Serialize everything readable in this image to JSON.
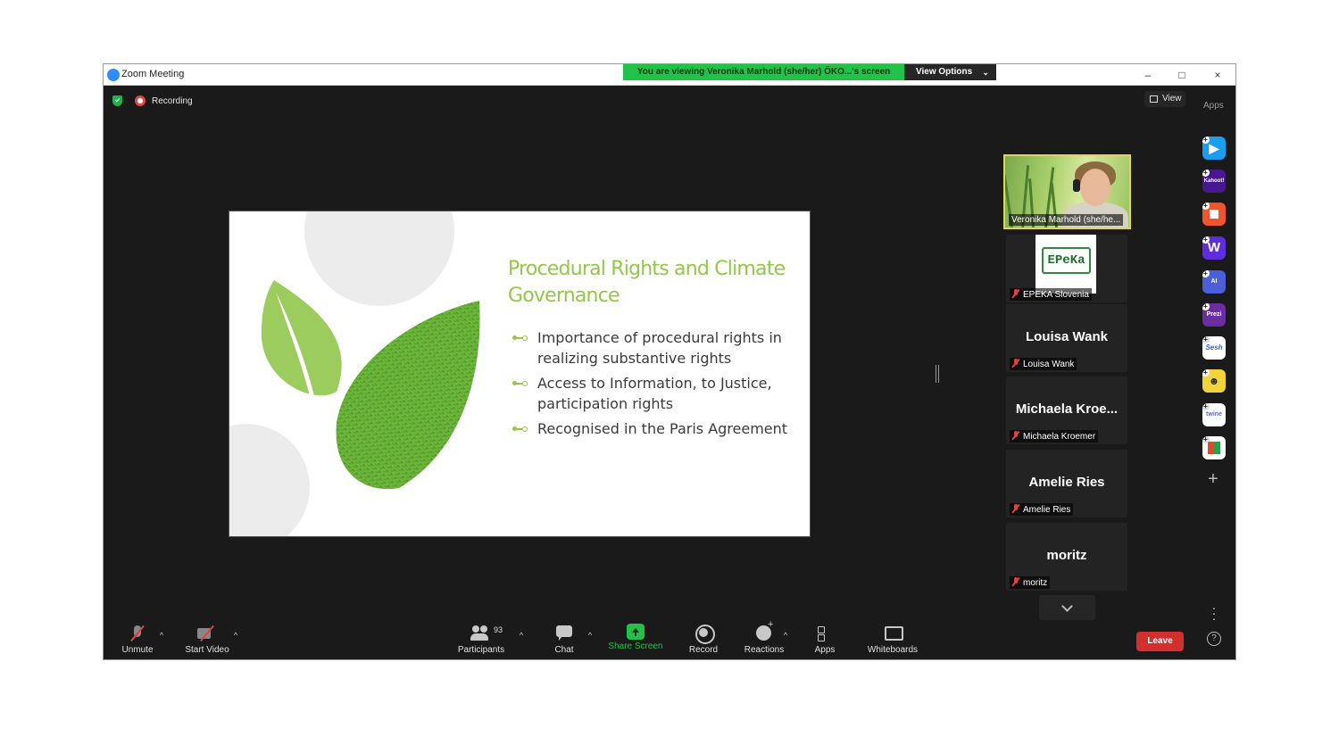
{
  "window": {
    "title": "Zoom Meeting",
    "banner": "You are viewing Veronika Marhold (she/her) ÖKO...'s screen",
    "view_options": "View Options",
    "controls": [
      "–",
      "□",
      "×"
    ]
  },
  "status": {
    "recording": "Recording",
    "view": "View",
    "apps": "Apps"
  },
  "slide": {
    "title": "Procedural Rights and Climate Governance",
    "bullets": [
      "Importance of procedural rights in realizing substantive rights",
      "Access to Information, to Justice, participation rights",
      "Recognised in the Paris Agreement"
    ],
    "accent_color": "#92c845"
  },
  "participants_panel": {
    "active_speaker": "Veronika Marhold (she/he...",
    "tiles": [
      {
        "big": "",
        "name": "EPEKA Slovenia",
        "logo_text": "EPeKa"
      },
      {
        "big": "Louisa Wank",
        "name": "Louisa Wank"
      },
      {
        "big": "Michaela  Kroe...",
        "name": "Michaela Kroemer"
      },
      {
        "big": "Amelie Ries",
        "name": "Amelie Ries"
      },
      {
        "big": "moritz",
        "name": "moritz"
      }
    ]
  },
  "side_apps": [
    {
      "name": "app-1",
      "label": "",
      "color": "#1a9ff0"
    },
    {
      "name": "kahoot",
      "label": "Kahoot!",
      "color": "#46178f"
    },
    {
      "name": "app-3",
      "label": "",
      "color": "#f2552c"
    },
    {
      "name": "wooclap",
      "label": "W",
      "color": "#5f2de0"
    },
    {
      "name": "ai-app",
      "label": "AI",
      "color": "#4a5fd8"
    },
    {
      "name": "prezi",
      "label": "Prezi",
      "color": "#6a2ea0"
    },
    {
      "name": "sesh",
      "label": "Sesh",
      "color": "#ffffff"
    },
    {
      "name": "emoji-app",
      "label": "",
      "color": "#f2d33a"
    },
    {
      "name": "twine",
      "label": "twine",
      "color": "#ffffff"
    },
    {
      "name": "grid-app",
      "label": "",
      "color": "#ffffff"
    }
  ],
  "toolbar": {
    "unmute": "Unmute",
    "start_video": "Start Video",
    "participants": "Participants",
    "participant_count": "93",
    "chat": "Chat",
    "share_screen": "Share Screen",
    "record": "Record",
    "reactions": "Reactions",
    "apps": "Apps",
    "whiteboards": "Whiteboards",
    "leave": "Leave",
    "help": "?"
  },
  "colors": {
    "share_green": "#22c24a",
    "leave_red": "#d32f2f",
    "speaker_border": "#e3d35a"
  }
}
